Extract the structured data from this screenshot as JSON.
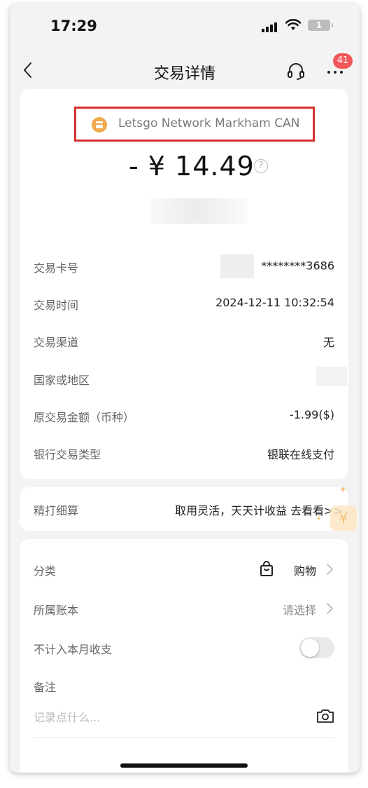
{
  "status_bar": {
    "time": "17:29",
    "battery": "1"
  },
  "nav": {
    "title": "交易详情",
    "badge_count": "41"
  },
  "merchant": {
    "name": "Letsgo Network Markham CAN"
  },
  "amount": {
    "text": "- ¥ 14.49",
    "help": "?"
  },
  "details": [
    {
      "label": "交易卡号",
      "value": "********3686"
    },
    {
      "label": "交易时间",
      "value": "2024-12-11 10:32:54"
    },
    {
      "label": "交易渠道",
      "value": "无"
    },
    {
      "label": "国家或地区",
      "value": ""
    },
    {
      "label": "原交易金额（币种）",
      "value": "-1.99($)"
    },
    {
      "label": "银行交易类型",
      "value": "银联在线支付"
    }
  ],
  "promo": {
    "label": "精打细算",
    "text": "取用灵活，天天计收益 去看看>>",
    "deco": "¥"
  },
  "settings": {
    "category_label": "分类",
    "category_value": "购物",
    "book_label": "所属账本",
    "book_value": "请选择",
    "exclude_label": "不计入本月收支",
    "exclude_on": false,
    "note_label": "备注",
    "note_placeholder": "记录点什么..."
  },
  "colors": {
    "highlight_border": "#d62f2f",
    "badge": "#f2575a",
    "merchant_icon": "#f0a94a"
  },
  "icons": [
    "back-icon",
    "headset-icon",
    "more-icon",
    "help-icon",
    "shopping-bag-icon",
    "chevron-right-icon",
    "camera-icon"
  ]
}
